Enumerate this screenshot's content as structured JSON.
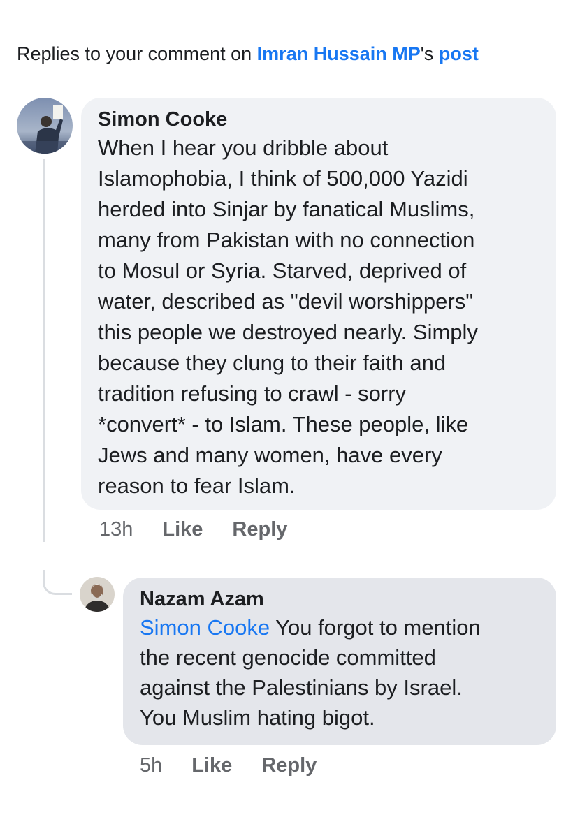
{
  "header": {
    "prefix": "Replies to your comment on ",
    "page_name": "Imran Hussain MP",
    "possessive": "'s ",
    "post_link": "post"
  },
  "comments": [
    {
      "author": "Simon Cooke",
      "text": "When I hear you dribble about\nIslamophobia, I think of 500,000 Yazidi\nherded into Sinjar by fanatical Muslims,\nmany from Pakistan with no connection\nto Mosul or Syria. Starved, deprived of\nwater, described as \"devil worshippers\"\nthis people we destroyed nearly. Simply\nbecause they clung to their faith and\ntradition refusing to crawl - sorry\n*convert* - to Islam. These people, like\nJews and many women, have every\nreason to fear Islam.",
      "time": "13h",
      "like_label": "Like",
      "reply_label": "Reply"
    },
    {
      "author": "Nazam Azam",
      "mention": "Simon Cooke",
      "text": " You forgot to mention\nthe recent genocide committed\nagainst the Palestinians by Israel.\nYou Muslim hating bigot.",
      "time": "5h",
      "like_label": "Like",
      "reply_label": "Reply"
    }
  ],
  "colors": {
    "link": "#1877f2",
    "bubble_primary": "#f0f2f5",
    "bubble_reply": "#e4e6eb",
    "meta": "#65676b"
  }
}
